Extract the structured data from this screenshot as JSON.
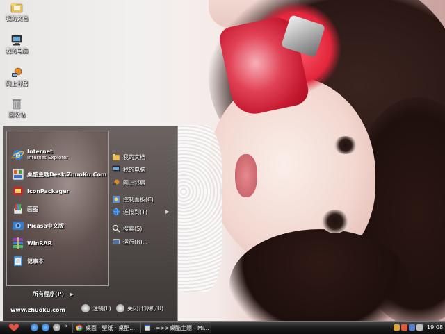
{
  "desktop": {
    "icons": [
      {
        "label": "我的文档",
        "icon": "my-documents-folder-icon"
      },
      {
        "label": "我的电脑",
        "icon": "my-computer-icon"
      },
      {
        "label": "网上邻居",
        "icon": "network-places-icon"
      },
      {
        "label": "回收站",
        "icon": "recycle-bin-icon"
      }
    ]
  },
  "start_menu": {
    "pinned": [
      {
        "title": "Internet",
        "subtitle": "Internet Explorer",
        "icon": "internet-explorer-icon"
      },
      {
        "title": "桌酷主题Desk.ZhuoKu.Com",
        "subtitle": "",
        "icon": "zhuoku-theme-icon"
      },
      {
        "title": "IconPackager",
        "subtitle": "",
        "icon": "iconpackager-icon"
      },
      {
        "title": "画图",
        "subtitle": "",
        "icon": "paint-icon"
      },
      {
        "title": "Picasa中文版",
        "subtitle": "",
        "icon": "picasa-icon"
      },
      {
        "title": "WinRAR",
        "subtitle": "",
        "icon": "winrar-icon"
      },
      {
        "title": "记事本",
        "subtitle": "",
        "icon": "notepad-icon"
      }
    ],
    "right_items": [
      {
        "label": "我的文档",
        "icon": "folder-icon",
        "arrow": ""
      },
      {
        "label": "我的电脑",
        "icon": "computer-icon",
        "arrow": ""
      },
      {
        "label": "网上邻居",
        "icon": "network-icon",
        "arrow": ""
      },
      {
        "label": "控制面板(C)",
        "icon": "control-panel-icon",
        "arrow": ""
      },
      {
        "label": "连接到(T)",
        "icon": "connect-icon",
        "arrow": "▶"
      },
      {
        "label": "搜索(S)",
        "icon": "search-icon",
        "arrow": ""
      },
      {
        "label": "运行(R)...",
        "icon": "run-icon",
        "arrow": ""
      }
    ],
    "all_programs": "所有程序(P)",
    "all_programs_arrow": "▶",
    "website": "www.zhuoku.com",
    "logoff": "注销(L)",
    "shutdown": "关闭计算机(U)"
  },
  "taskbar": {
    "tasks": [
      {
        "label": "桌面 · 壁纸 · 桌酷...",
        "icon": "chrome-icon"
      },
      {
        "label": "-=>>桌酷主题 - Mi...",
        "icon": "window-icon"
      }
    ],
    "overflow": "»",
    "clock": "19:08"
  },
  "colors": {
    "taskbar_bg": "#1a1a1a",
    "start_menu_bg": "#3a3230"
  }
}
